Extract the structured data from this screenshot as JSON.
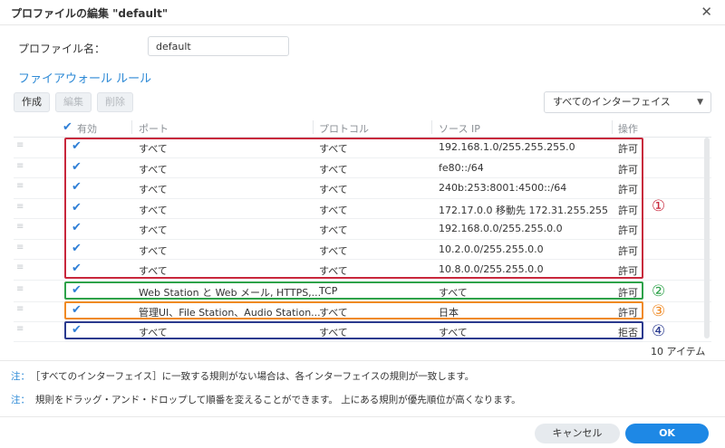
{
  "dialog": {
    "title": "プロファイルの編集 \"default\"",
    "close_glyph": "✕"
  },
  "profile": {
    "label": "プロファイル名：",
    "value": "default"
  },
  "section_title": "ファイアウォール ルール",
  "toolbar": {
    "create_label": "作成",
    "edit_label": "編集",
    "delete_label": "削除",
    "interface_select": "すべてのインターフェイス"
  },
  "grid": {
    "headers": {
      "enabled": "有効",
      "port": "ポート",
      "protocol": "プロトコル",
      "source_ip": "ソース IP",
      "action": "操作"
    },
    "rows": [
      {
        "port": "すべて",
        "protocol": "すべて",
        "source_ip": "192.168.1.0/255.255.255.0",
        "action": "許可"
      },
      {
        "port": "すべて",
        "protocol": "すべて",
        "source_ip": "fe80::/64",
        "action": "許可"
      },
      {
        "port": "すべて",
        "protocol": "すべて",
        "source_ip": "240b:253:8001:4500::/64",
        "action": "許可"
      },
      {
        "port": "すべて",
        "protocol": "すべて",
        "source_ip": "172.17.0.0 移動先 172.31.255.255",
        "action": "許可"
      },
      {
        "port": "すべて",
        "protocol": "すべて",
        "source_ip": "192.168.0.0/255.255.0.0",
        "action": "許可"
      },
      {
        "port": "すべて",
        "protocol": "すべて",
        "source_ip": "10.2.0.0/255.255.0.0",
        "action": "許可"
      },
      {
        "port": "すべて",
        "protocol": "すべて",
        "source_ip": "10.8.0.0/255.255.0.0",
        "action": "許可"
      },
      {
        "port": "Web Station と Web メール, HTTPS,...",
        "protocol": "TCP",
        "source_ip": "すべて",
        "action": "許可"
      },
      {
        "port": "管理UI、File Station、Audio Station...",
        "protocol": "すべて",
        "source_ip": "日本",
        "action": "許可"
      },
      {
        "port": "すべて",
        "protocol": "すべて",
        "source_ip": "すべて",
        "action": "拒否"
      }
    ],
    "item_count": "10 アイテム"
  },
  "annotations": {
    "mark1": "①",
    "mark2": "②",
    "mark3": "③",
    "mark4": "④",
    "colors": {
      "box1": "#c8273c",
      "box2": "#2ea24a",
      "box3": "#f08a24",
      "box4": "#2a3a8f"
    }
  },
  "notes": {
    "tag": "注：",
    "note1": "［すべてのインターフェイス］に一致する規則がない場合は、各インターフェイスの規則が一致します。",
    "note2": "規則をドラッグ・アンド・ドロップして順番を変えることができます。 上にある規則が優先順位が高くなります。"
  },
  "footer": {
    "cancel_label": "キャンセル",
    "ok_label": "OK"
  },
  "colors": {
    "accent": "#1e88e5",
    "link": "#2e8ad6"
  }
}
